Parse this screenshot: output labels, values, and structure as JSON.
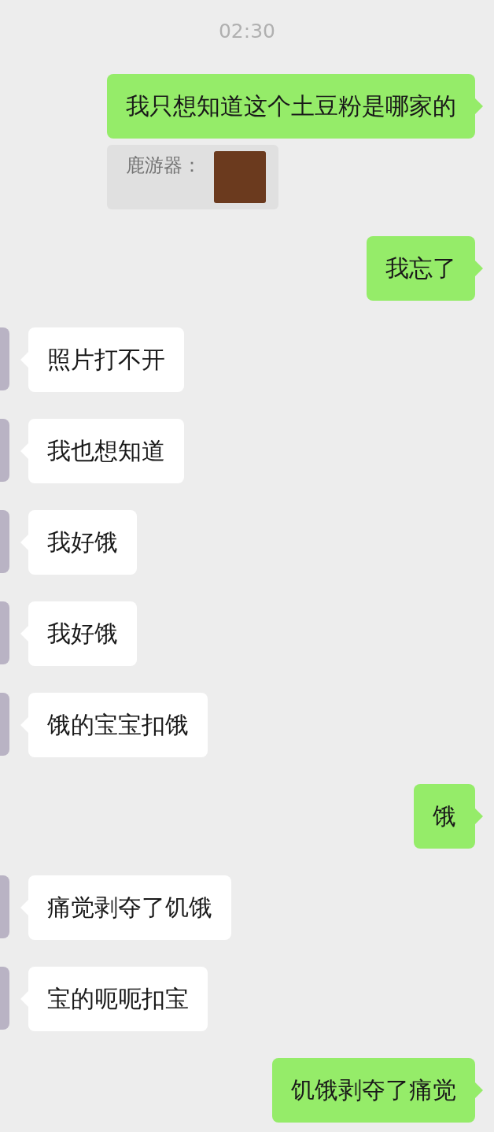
{
  "time": "02:30",
  "messages": [
    {
      "kind": "sent",
      "text": "我只想知道这个土豆粉是哪家的",
      "quote": {
        "sender": "鹿游器："
      }
    },
    {
      "kind": "sent",
      "text": "我忘了"
    },
    {
      "kind": "received",
      "text": "照片打不开"
    },
    {
      "kind": "received",
      "text": "我也想知道"
    },
    {
      "kind": "received",
      "text": "我好饿"
    },
    {
      "kind": "received",
      "text": "我好饿"
    },
    {
      "kind": "received",
      "text": "饿的宝宝扣饿"
    },
    {
      "kind": "sent",
      "text": "饿"
    },
    {
      "kind": "received",
      "text": "痛觉剥夺了饥饿"
    },
    {
      "kind": "received",
      "text": "宝的呃呃扣宝"
    },
    {
      "kind": "sent",
      "text": "饥饿剥夺了痛觉"
    }
  ]
}
